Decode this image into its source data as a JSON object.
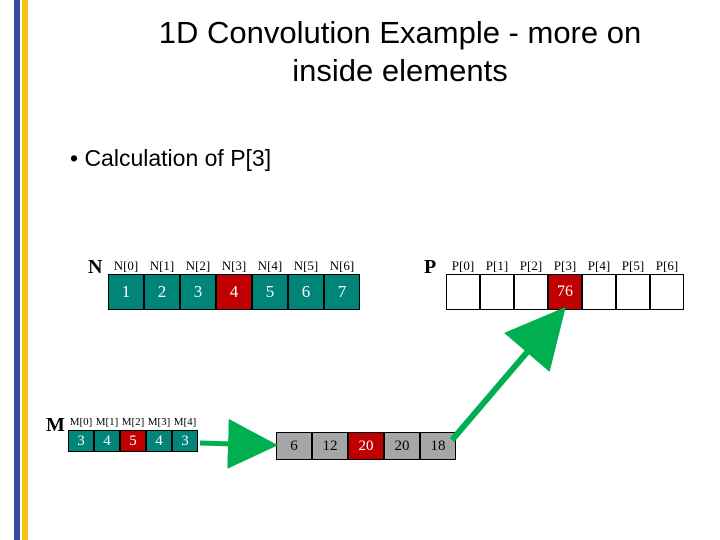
{
  "title": "1D Convolution Example - more on inside elements",
  "bullet": "• Calculation of P[3]",
  "arrays": {
    "N": {
      "letter": "N",
      "labels": [
        "N[0]",
        "N[1]",
        "N[2]",
        "N[3]",
        "N[4]",
        "N[5]",
        "N[6]"
      ],
      "values": [
        "1",
        "2",
        "3",
        "4",
        "5",
        "6",
        "7"
      ],
      "highlight": {
        "3": "red"
      },
      "base": "teal"
    },
    "P": {
      "letter": "P",
      "labels": [
        "P[0]",
        "P[1]",
        "P[2]",
        "P[3]",
        "P[4]",
        "P[5]",
        "P[6]"
      ],
      "values": [
        "",
        "",
        "",
        "76",
        "",
        "",
        ""
      ],
      "highlight": {
        "3": "red"
      },
      "base": ""
    },
    "M": {
      "letter": "M",
      "labels": [
        "M[0]",
        "M[1]",
        "M[2]",
        "M[3]",
        "M[4]"
      ],
      "values": [
        "3",
        "4",
        "5",
        "4",
        "3"
      ],
      "highlight": {
        "2": "red"
      },
      "base": "teal"
    },
    "prod": {
      "values": [
        "6",
        "12",
        "20",
        "20",
        "18"
      ],
      "highlight": {
        "2": "red"
      },
      "base": "gray"
    }
  }
}
